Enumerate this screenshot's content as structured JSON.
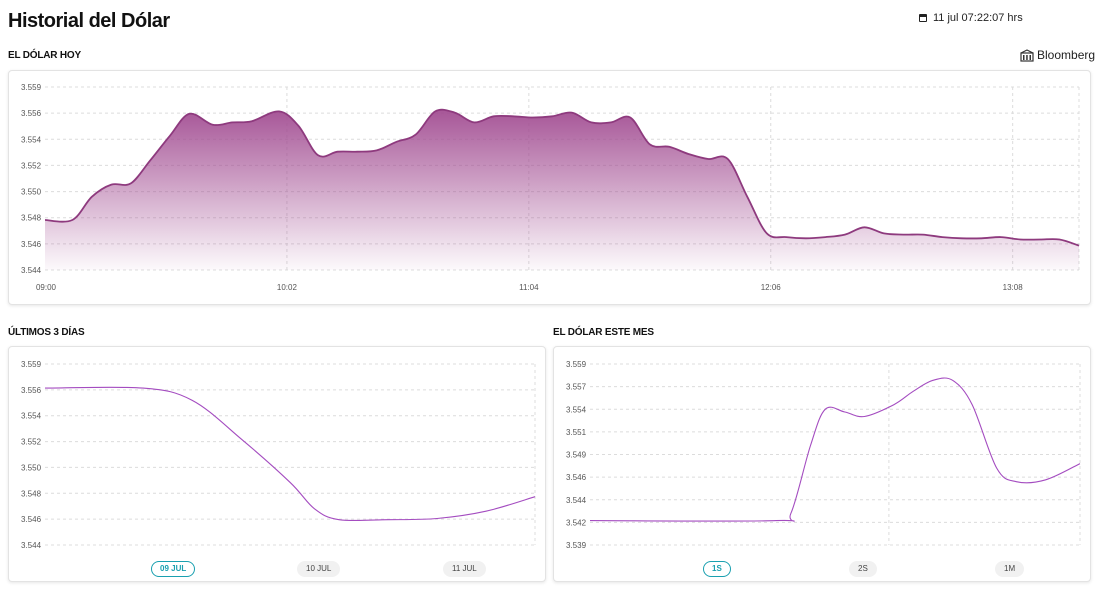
{
  "header": {
    "title": "Historial del Dólar",
    "timestamp": "11 jul 07:22:07 hrs",
    "calendar_icon": "calendar-icon"
  },
  "colors": {
    "line_today": "#8e3a7e",
    "fill_top": "#a24d92",
    "line_small": "#a44cc0",
    "active_pill": "#1aa0b0"
  },
  "today": {
    "title": "EL DÓLAR HOY",
    "source_label": "Bloomberg",
    "source_icon": "building-icon"
  },
  "three_days": {
    "title": "ÚLTIMOS 3 DÍAS",
    "tabs": [
      {
        "label": "09 JUL",
        "active": true
      },
      {
        "label": "10 JUL",
        "active": false
      },
      {
        "label": "11 JUL",
        "active": false
      }
    ]
  },
  "month": {
    "title": "EL DÓLAR ESTE MES",
    "tabs": [
      {
        "label": "1S",
        "active": true
      },
      {
        "label": "2S",
        "active": false
      },
      {
        "label": "1M",
        "active": false
      }
    ]
  },
  "chart_data": [
    {
      "type": "area",
      "title": "EL DÓLAR HOY",
      "x_ticks": [
        "09:00",
        "10:02",
        "11:04",
        "12:06",
        "13:08"
      ],
      "y_ticks": [
        "3.559",
        "3.556",
        "3.554",
        "3.552",
        "3.550",
        "3.548",
        "3.546",
        "3.544"
      ],
      "x_range_minutes": [
        0,
        265
      ],
      "ylim": [
        3.544,
        3.559
      ],
      "grid": true,
      "series": [
        {
          "x": [
            0,
            7,
            12,
            17,
            22,
            27,
            32,
            37,
            43,
            48,
            53,
            60,
            65,
            70,
            75,
            80,
            85,
            90,
            95,
            100,
            105,
            110,
            115,
            120,
            125,
            130,
            135,
            140,
            145,
            150,
            155,
            160,
            165,
            170,
            175,
            180,
            185,
            190,
            195,
            200,
            205,
            210,
            215,
            220,
            225,
            230,
            235,
            240,
            245,
            250,
            255,
            260,
            265
          ],
          "values": [
            3.5481,
            3.5481,
            3.55,
            3.551,
            3.5511,
            3.553,
            3.555,
            3.5568,
            3.5559,
            3.5561,
            3.5562,
            3.557,
            3.5558,
            3.5534,
            3.5537,
            3.5537,
            3.5538,
            3.5545,
            3.5551,
            3.557,
            3.5569,
            3.5561,
            3.5566,
            3.5566,
            3.5565,
            3.5566,
            3.5569,
            3.5561,
            3.5561,
            3.5565,
            3.5543,
            3.5541,
            3.5535,
            3.5531,
            3.5531,
            3.55,
            3.547,
            3.5467,
            3.5466,
            3.5467,
            3.5469,
            3.5475,
            3.547,
            3.5469,
            3.5469,
            3.5467,
            3.5466,
            3.5466,
            3.5467,
            3.5465,
            3.5465,
            3.5465,
            3.546
          ]
        }
      ]
    },
    {
      "type": "line",
      "title": "ÚLTIMOS 3 DÍAS",
      "y_ticks": [
        "3.559",
        "3.556",
        "3.554",
        "3.552",
        "3.550",
        "3.548",
        "3.546",
        "3.544"
      ],
      "ylim": [
        3.544,
        3.559
      ],
      "grid": true,
      "series": [
        {
          "x": [
            0,
            0.2,
            0.3,
            0.4,
            0.5,
            0.55,
            0.6,
            0.7,
            0.8,
            0.9,
            1.0
          ],
          "values": [
            3.557,
            3.557,
            3.556,
            3.5528,
            3.5492,
            3.547,
            3.5461,
            3.5461,
            3.5462,
            3.5468,
            3.548
          ]
        }
      ]
    },
    {
      "type": "line",
      "title": "EL DÓLAR ESTE MES",
      "y_ticks": [
        "3.559",
        "3.557",
        "3.554",
        "3.551",
        "3.549",
        "3.546",
        "3.544",
        "3.542",
        "3.539"
      ],
      "ylim": [
        3.539,
        3.559
      ],
      "grid": true,
      "series": [
        {
          "x": [
            0,
            0.38,
            0.41,
            0.45,
            0.48,
            0.52,
            0.56,
            0.62,
            0.66,
            0.7,
            0.74,
            0.78,
            0.83,
            0.87,
            0.93,
            1.0
          ],
          "values": [
            3.5417,
            3.5417,
            3.5425,
            3.55,
            3.554,
            3.5537,
            3.5532,
            3.5545,
            3.556,
            3.5572,
            3.5572,
            3.5545,
            3.5475,
            3.546,
            3.5462,
            3.548
          ]
        }
      ]
    }
  ]
}
